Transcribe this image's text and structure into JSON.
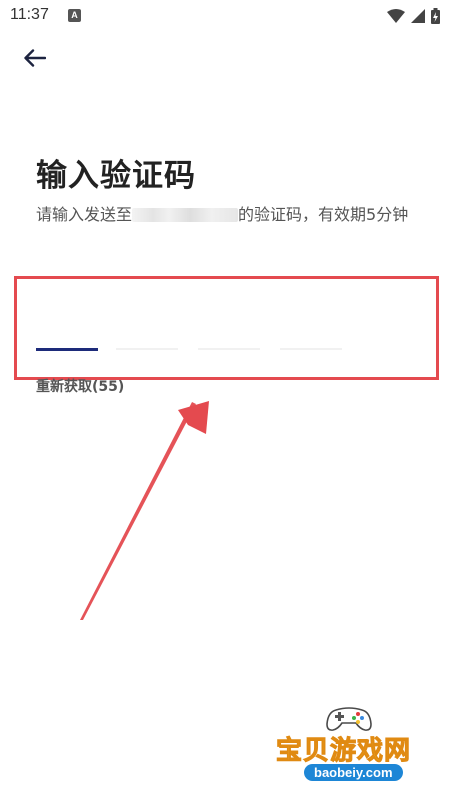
{
  "status_bar": {
    "time": "11:37",
    "notification_icon": "A"
  },
  "header": {
    "back_icon": "arrow-left-icon"
  },
  "main": {
    "title": "输入验证码",
    "subtitle_prefix": "请输入发送至",
    "subtitle_suffix": "的验证码，有效期5分钟",
    "code_slots": 4,
    "active_slot": 1,
    "resend_label": "重新获取(55)"
  },
  "annotation": {
    "color": "#e44a4f"
  },
  "watermark": {
    "title": "宝贝游戏网",
    "url": "baobeiy.com"
  },
  "colors": {
    "active_underline": "#1d2b7a",
    "highlight": "#e44a4f"
  }
}
